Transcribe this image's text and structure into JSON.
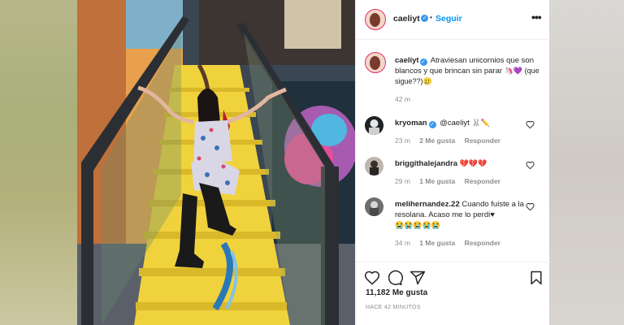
{
  "post": {
    "author": "caeliyt",
    "follow_label": "Seguir",
    "separator": "•",
    "more_label": "•••"
  },
  "caption": {
    "author": "caeliyt",
    "text": "Atraviesan unicornios que son blancos y que brincan sin parar",
    "emojis": "🦄💜 (que sigue??)🥲",
    "time": "42 m"
  },
  "comments": [
    {
      "user": "kryoman",
      "text": "@caeliyt",
      "emojis": "🐰✏️",
      "time": "23 m",
      "likes": "2 Me gusta",
      "reply": "Responder"
    },
    {
      "user": "briggithalejandra",
      "text": "",
      "emojis": "💔💔💔",
      "time": "29 m",
      "likes": "1 Me gusta",
      "reply": "Responder"
    },
    {
      "user": "melihernandez.22",
      "text": "Cuando fuiste a la resolana. Acaso me lo perdi♥",
      "emojis": "😭😭😭😭😭",
      "time": "34 m",
      "likes": "1 Me gusta",
      "reply": "Responder"
    }
  ],
  "stats": {
    "likes": "11,182 Me gusta",
    "ago": "HACE 42 MINUTOS"
  },
  "icons": [
    "heart-icon",
    "comment-icon",
    "share-icon",
    "bookmark-icon",
    "verified-icon",
    "more-icon"
  ],
  "colors": {
    "link": "#0095f6",
    "verified": "#3897f0",
    "meta": "#8e8e8e",
    "text": "#262626"
  }
}
